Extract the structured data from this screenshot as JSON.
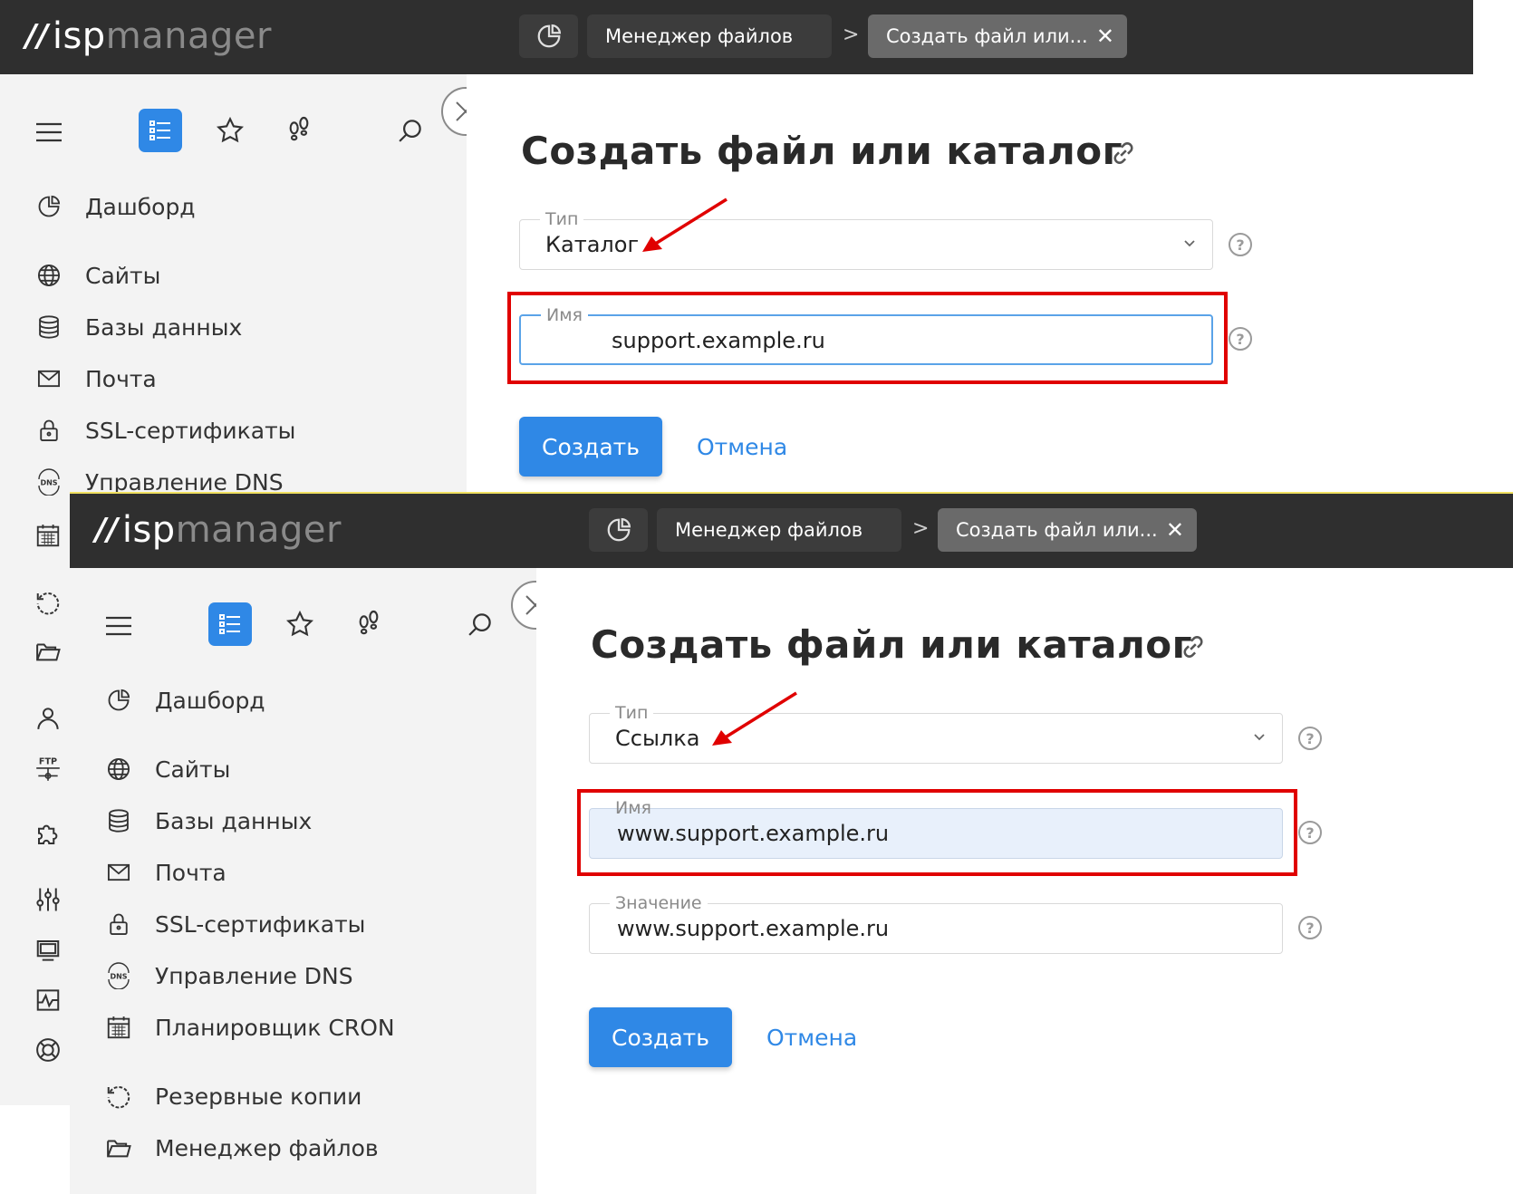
{
  "brand": {
    "bars": "//",
    "isp": "isp",
    "manager": "manager"
  },
  "topbar": {
    "crumb": "Менеджер файлов",
    "separator": ">",
    "active_tab": "Создать файл или...",
    "close_glyph": "✕"
  },
  "menu": {
    "dashboard": "Дашборд",
    "sites": "Сайты",
    "databases": "Базы данных",
    "mail": "Почта",
    "ssl": "SSL-сертификаты",
    "dns": "Управление DNS",
    "cron": "Планировщик CRON",
    "backups": "Резервные копии",
    "file_manager": "Менеджер файлов"
  },
  "form": {
    "title": "Создать файл или каталог",
    "type_label": "Тип",
    "name_label": "Имя",
    "value_label": "Значение",
    "help_glyph": "?",
    "create": "Создать",
    "cancel": "Отмена"
  },
  "shot1": {
    "type_value": "Каталог",
    "name_value": "support.example.ru"
  },
  "shot2": {
    "type_value": "Ссылка",
    "name_value": "www.support.example.ru",
    "value_value": "www.support.example.ru"
  },
  "colors": {
    "topbar": "#2f2f2f",
    "accent": "#2f88e6",
    "highlight": "#e00000",
    "sidebar": "#f3f3f3"
  }
}
